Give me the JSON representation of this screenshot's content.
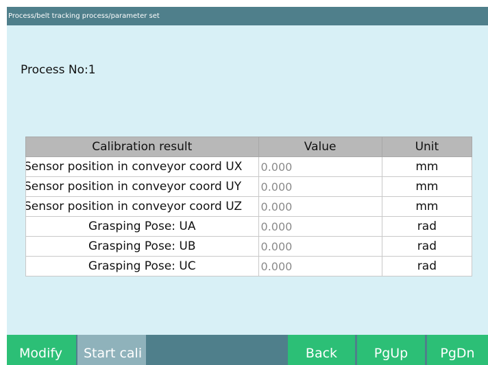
{
  "header": {
    "breadcrumb": "Process/belt tracking process/parameter set"
  },
  "process": {
    "label": "Process No:1"
  },
  "table": {
    "columns": [
      "Calibration result",
      "Value",
      "Unit"
    ],
    "rows": [
      {
        "name": "Sensor position in conveyor coord UX",
        "value": "0.000",
        "unit": "mm"
      },
      {
        "name": "Sensor position in conveyor coord UY",
        "value": "0.000",
        "unit": "mm"
      },
      {
        "name": "Sensor position in conveyor coord UZ",
        "value": "0.000",
        "unit": "mm"
      },
      {
        "name": "Grasping Pose: UA",
        "value": "0.000",
        "unit": "rad"
      },
      {
        "name": "Grasping Pose: UB",
        "value": "0.000",
        "unit": "rad"
      },
      {
        "name": "Grasping Pose: UC",
        "value": "0.000",
        "unit": "rad"
      }
    ]
  },
  "buttons": {
    "modify": "Modify",
    "start_cali": "Start cali",
    "back": "Back",
    "pgup": "PgUp",
    "pgdn": "PgDn"
  },
  "colors": {
    "header_bg": "#4f7f8b",
    "content_bg": "#d8f0f6",
    "button_green": "#2cbf76",
    "button_disabled": "#8fb2bb"
  }
}
